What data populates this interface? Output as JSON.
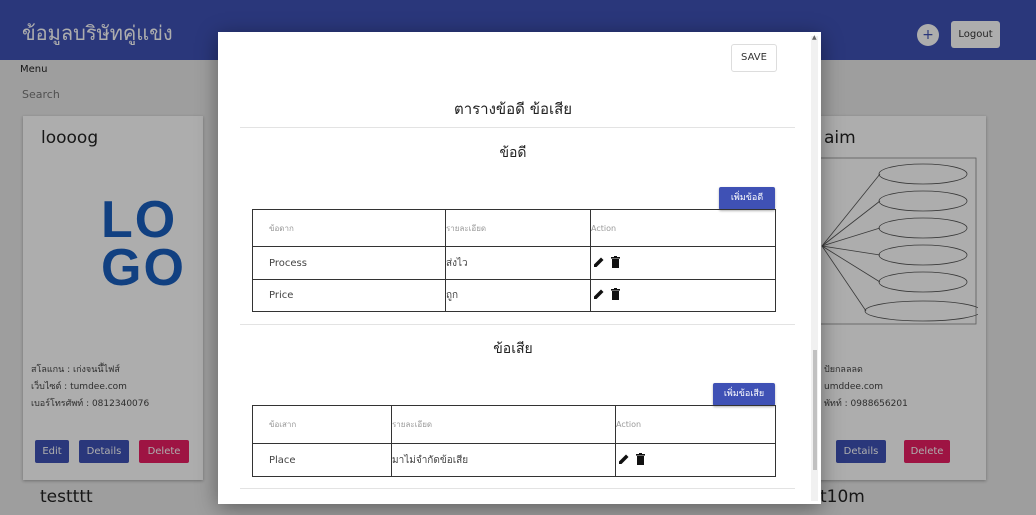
{
  "app": {
    "title": "ข้อมูลบริษัทคู่แข่ง",
    "add_label": "+",
    "logout_label": "Logout",
    "menu_label": "Menu",
    "search_label": "Search"
  },
  "cards": [
    {
      "title": "loooog",
      "logo_text_line1": "LO",
      "logo_text_line2": "GO",
      "info": [
        "สโลแกน : เก่งจนนึ้ไฟส์",
        "เว็บไซต์ : tumdee.com",
        "เบอร์โทรศัพท์ : 0812340076"
      ],
      "edit_label": "Edit",
      "details_label": "Details",
      "delete_label": "Delete"
    },
    {
      "title": "aim",
      "info": [
        "ปัยกลลลด",
        "umddee.com",
        "พัทท์ : 0988656201"
      ],
      "details_label": "Details",
      "delete_label": "Delete"
    }
  ],
  "below_cards": [
    "testttt",
    "t10m"
  ],
  "modal": {
    "save_label": "SAVE",
    "heading": "ตารางข้อดี ข้อเสีย",
    "pros": {
      "title": "ข้อดี",
      "add_label": "เพิ่มข้อดี",
      "columns": [
        "ข้อดาก",
        "รายละเอียด",
        "Action"
      ],
      "rows": [
        {
          "topic": "Process",
          "detail": "ส่งไว"
        },
        {
          "topic": "Price",
          "detail": "ถูก"
        }
      ]
    },
    "cons": {
      "title": "ข้อเสีย",
      "add_label": "เพิ่มข้อเสีย",
      "columns": [
        "ข้อเสาก",
        "รายละเอียด",
        "Action"
      ],
      "rows": [
        {
          "topic": "Place",
          "detail": "มาไม่จำกัดข้อเสีย"
        }
      ]
    }
  },
  "colors": {
    "primary": "#3f51b5",
    "danger": "#e91e63"
  }
}
